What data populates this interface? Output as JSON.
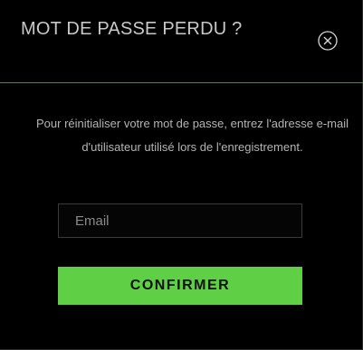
{
  "modal": {
    "title": "MOT DE PASSE PERDU ?",
    "close_icon": "close-circle-icon",
    "instructions": "Pour réinitialiser votre mot de passe, entrez l'adresse e-mail d'utilisateur utilisé lors de l'enregistrement.",
    "email_placeholder": "Email",
    "email_value": "",
    "confirm_label": "CONFIRMER"
  },
  "colors": {
    "background": "#000000",
    "accent": "#5fcf45",
    "divider": "#4a8a3e",
    "title_text": "#c8c8c8",
    "body_text": "#b4b4b4"
  }
}
